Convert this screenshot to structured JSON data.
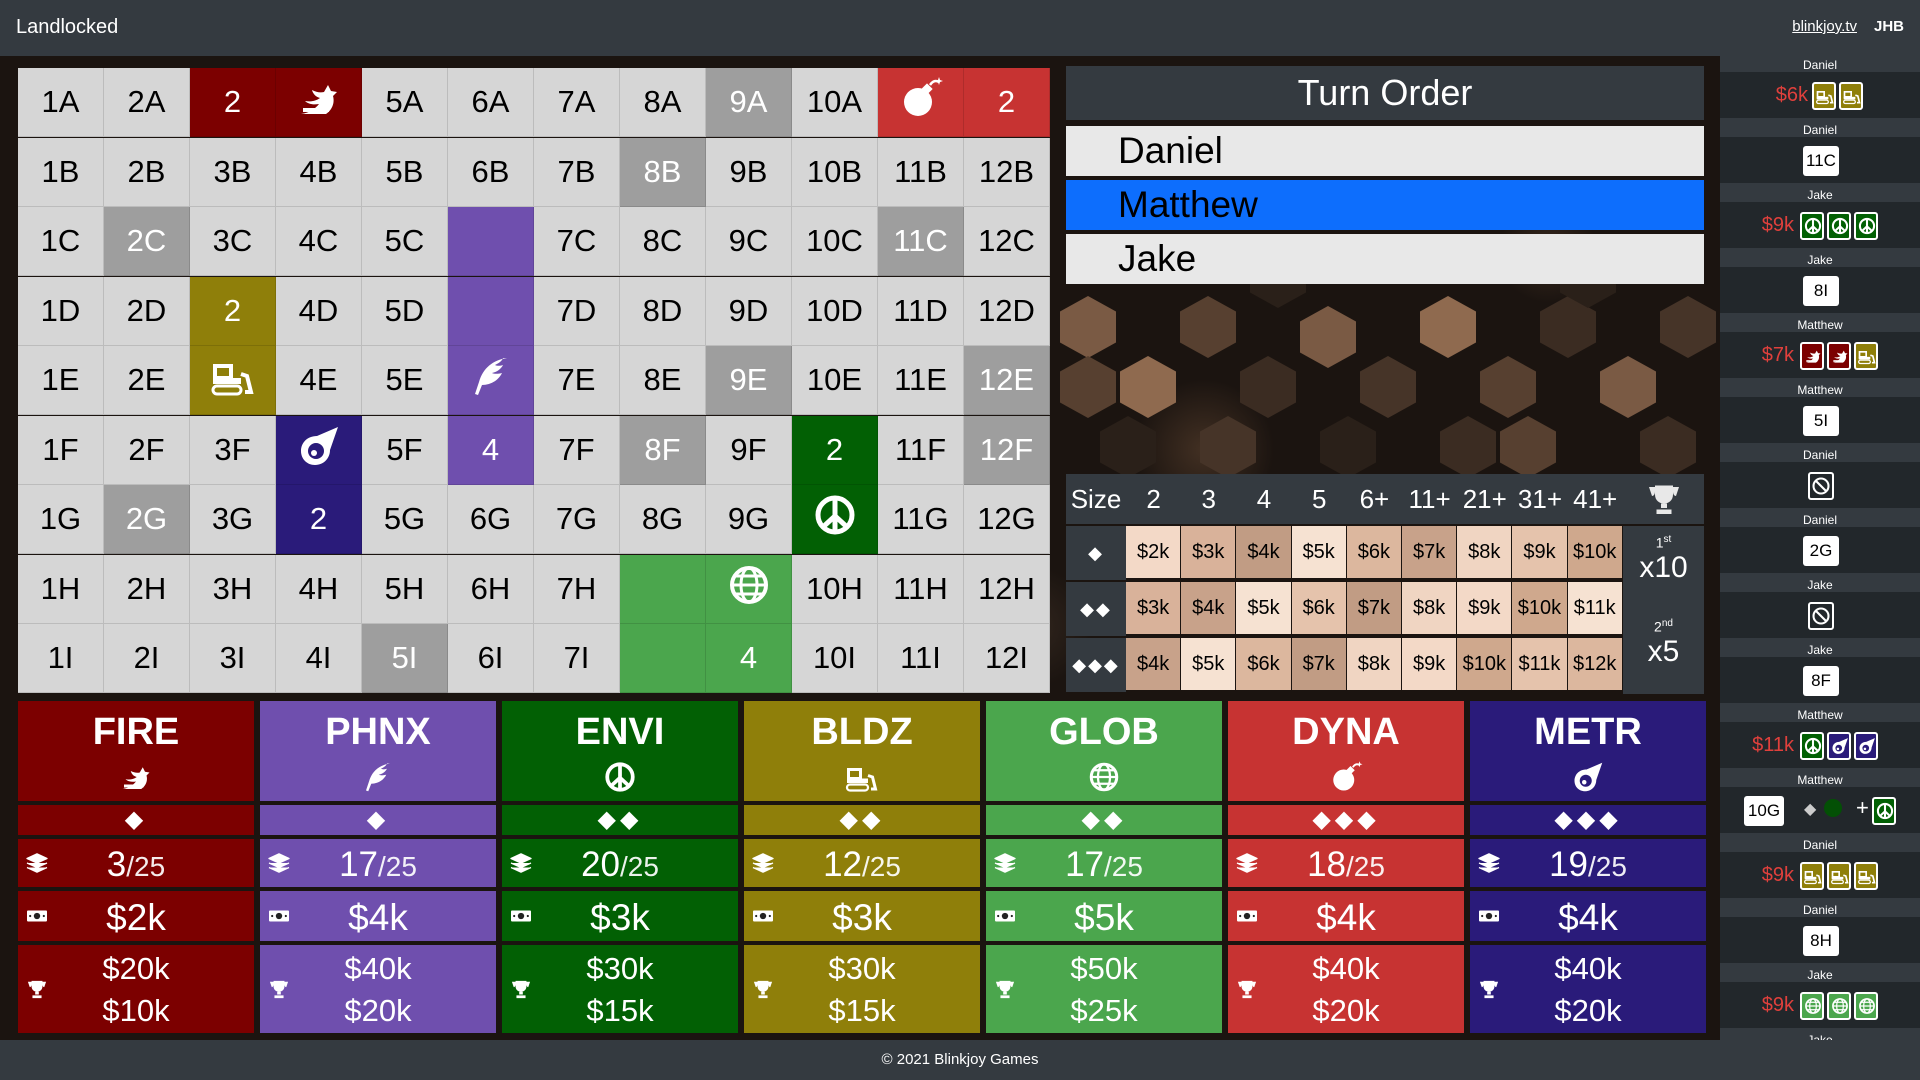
{
  "header": {
    "title": "Landlocked",
    "site": "blinkjoy.tv",
    "user": "JHB"
  },
  "colors": {
    "FIRE": "#7c0000",
    "PHNX": "#6f4fae",
    "ENVI": "#026004",
    "BLDZ": "#8f7f0a",
    "GLOB": "#4ba64d",
    "DYNA": "#c73332",
    "METR": "#2a1b7a",
    "cell": "#d6d6d6",
    "dark": "#9e9e9e",
    "active": "#0d6efd"
  },
  "board": {
    "rows": [
      "A",
      "B",
      "C",
      "D",
      "E",
      "F",
      "G",
      "H",
      "I"
    ],
    "cells": [
      [
        "1A",
        "2A",
        "2",
        "FIRE_ICON",
        "5A",
        "6A",
        "7A",
        "8A",
        "9A",
        "10A",
        "DYNA_ICON",
        "2"
      ],
      [
        "1B",
        "2B",
        "3B",
        "4B",
        "5B",
        "6B",
        "7B",
        "8B",
        "9B",
        "10B",
        "11B",
        "12B"
      ],
      [
        "1C",
        "2C",
        "3C",
        "4C",
        "5C",
        "",
        "7C",
        "8C",
        "9C",
        "10C",
        "11C",
        "12C"
      ],
      [
        "1D",
        "2D",
        "2",
        "4D",
        "5D",
        "",
        "7D",
        "8D",
        "9D",
        "10D",
        "11D",
        "12D"
      ],
      [
        "1E",
        "2E",
        "BLDZ_ICON",
        "4E",
        "5E",
        "PHNX_ICON",
        "7E",
        "8E",
        "9E",
        "10E",
        "11E",
        "12E"
      ],
      [
        "1F",
        "2F",
        "3F",
        "METR_ICON",
        "5F",
        "4",
        "7F",
        "8F",
        "9F",
        "2",
        "11F",
        "12F"
      ],
      [
        "1G",
        "2G",
        "3G",
        "2",
        "5G",
        "6G",
        "7G",
        "8G",
        "9G",
        "ENVI_ICON",
        "11G",
        "12G"
      ],
      [
        "1H",
        "2H",
        "3H",
        "4H",
        "5H",
        "6H",
        "7H",
        "",
        "GLOB_ICON",
        "10H",
        "11H",
        "12H"
      ],
      [
        "1I",
        "2I",
        "3I",
        "4I",
        "5I",
        "6I",
        "7I",
        "",
        "4",
        "10I",
        "11I",
        "12I"
      ]
    ]
  },
  "turn_order": {
    "title": "Turn Order",
    "players": [
      "Daniel",
      "Matthew",
      "Jake"
    ],
    "active": "Matthew"
  },
  "price_table": {
    "size_label": "Size",
    "sizes": [
      "2",
      "3",
      "4",
      "5",
      "6+",
      "11+",
      "21+",
      "31+",
      "41+"
    ],
    "tiers": [
      {
        "label": "◆",
        "values": [
          "$2k",
          "$3k",
          "$4k",
          "$5k",
          "$6k",
          "$7k",
          "$8k",
          "$9k",
          "$10k"
        ]
      },
      {
        "label": "◆◆",
        "values": [
          "$3k",
          "$4k",
          "$5k",
          "$6k",
          "$7k",
          "$8k",
          "$9k",
          "$10k",
          "$11k"
        ]
      },
      {
        "label": "◆◆◆",
        "values": [
          "$4k",
          "$5k",
          "$6k",
          "$7k",
          "$8k",
          "$9k",
          "$10k",
          "$11k",
          "$12k"
        ]
      }
    ],
    "bonus": [
      {
        "place": "1",
        "suffix": "st",
        "mult": "x10"
      },
      {
        "place": "2",
        "suffix": "nd",
        "mult": "x5"
      }
    ]
  },
  "companies": [
    {
      "name": "FIRE",
      "icon": "dragon",
      "tier": "◆",
      "shares": "3",
      "total": "/25",
      "price": "$2k",
      "bonus1": "$20k",
      "bonus2": "$10k"
    },
    {
      "name": "PHNX",
      "icon": "feather",
      "tier": "◆",
      "shares": "17",
      "total": "/25",
      "price": "$4k",
      "bonus1": "$40k",
      "bonus2": "$20k"
    },
    {
      "name": "ENVI",
      "icon": "peace",
      "tier": "◆◆",
      "shares": "20",
      "total": "/25",
      "price": "$3k",
      "bonus1": "$30k",
      "bonus2": "$15k"
    },
    {
      "name": "BLDZ",
      "icon": "bulldozer",
      "tier": "◆◆",
      "shares": "12",
      "total": "/25",
      "price": "$3k",
      "bonus1": "$30k",
      "bonus2": "$15k"
    },
    {
      "name": "GLOB",
      "icon": "globe",
      "tier": "◆◆",
      "shares": "17",
      "total": "/25",
      "price": "$5k",
      "bonus1": "$50k",
      "bonus2": "$25k"
    },
    {
      "name": "DYNA",
      "icon": "bomb",
      "tier": "◆◆◆",
      "shares": "18",
      "total": "/25",
      "price": "$4k",
      "bonus1": "$40k",
      "bonus2": "$20k"
    },
    {
      "name": "METR",
      "icon": "meteor",
      "tier": "◆◆◆",
      "shares": "19",
      "total": "/25",
      "price": "$4k",
      "bonus1": "$40k",
      "bonus2": "$20k"
    }
  ],
  "log": [
    {
      "player": "Daniel",
      "type": "buy",
      "price": "$6k",
      "chips": [
        "BLDZ",
        "BLDZ"
      ]
    },
    {
      "player": "Daniel",
      "type": "place",
      "cell": "11C"
    },
    {
      "player": "Jake",
      "type": "buy",
      "price": "$9k",
      "chips": [
        "ENVI",
        "ENVI",
        "ENVI"
      ]
    },
    {
      "player": "Jake",
      "type": "place",
      "cell": "8I"
    },
    {
      "player": "Matthew",
      "type": "buy",
      "price": "$7k",
      "chips": [
        "FIRE",
        "FIRE",
        "BLDZ"
      ]
    },
    {
      "player": "Matthew",
      "type": "place",
      "cell": "5I"
    },
    {
      "player": "Daniel",
      "type": "pass"
    },
    {
      "player": "Daniel",
      "type": "place",
      "cell": "2G"
    },
    {
      "player": "Jake",
      "type": "pass"
    },
    {
      "player": "Jake",
      "type": "place",
      "cell": "8F"
    },
    {
      "player": "Matthew",
      "type": "buy",
      "price": "$11k",
      "chips": [
        "ENVI",
        "METR",
        "METR"
      ]
    },
    {
      "player": "Matthew",
      "type": "trade",
      "cell": "10G",
      "plus": "+"
    },
    {
      "player": "Daniel",
      "type": "buy",
      "price": "$9k",
      "chips": [
        "BLDZ",
        "BLDZ",
        "BLDZ"
      ]
    },
    {
      "player": "Daniel",
      "type": "place",
      "cell": "8H"
    },
    {
      "player": "Jake",
      "type": "buy",
      "price": "$9k",
      "chips": [
        "GLOB",
        "GLOB",
        "GLOB"
      ]
    },
    {
      "player": "Jake",
      "type": "cut"
    }
  ],
  "footer": "© 2021 Blinkjoy Games"
}
